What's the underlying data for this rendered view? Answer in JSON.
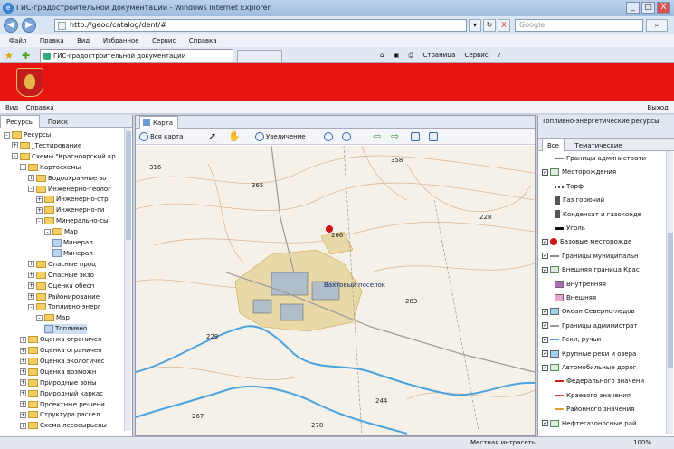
{
  "window": {
    "title": "ГИС-градостроительной документации - Windows Internet Explorer",
    "min": "_",
    "max": "□",
    "close": "X"
  },
  "address": {
    "url": "http://geod/catalog/dent/#",
    "go": "▾",
    "refresh": "↻",
    "stop": "X",
    "search_placeholder": "Google",
    "search_btn": "⌕"
  },
  "menu": [
    "Файл",
    "Правка",
    "Вид",
    "Избранное",
    "Сервис",
    "Справка"
  ],
  "browser_tab": {
    "title": "ГИС-градостроительной документации"
  },
  "commandbar": [
    "Страница",
    "Сервис"
  ],
  "appmenu": {
    "items": [
      "Вид",
      "Справка"
    ],
    "exit": "Выход"
  },
  "left_panel": {
    "tabs": [
      "Ресурсы",
      "Поиск"
    ],
    "tree": [
      {
        "label": "Ресурсы",
        "level": 0,
        "type": "folder",
        "toggle": "-"
      },
      {
        "label": "_Тестирование",
        "level": 1,
        "type": "folder",
        "toggle": "+"
      },
      {
        "label": "Схемы \"Красноярский кр",
        "level": 1,
        "type": "folder",
        "toggle": "-"
      },
      {
        "label": "Картосхемы",
        "level": 2,
        "type": "folder",
        "toggle": "-"
      },
      {
        "label": "Водоохранные зо",
        "level": 3,
        "type": "folder",
        "toggle": "+"
      },
      {
        "label": "Инженерно-геолог",
        "level": 3,
        "type": "folder",
        "toggle": "-"
      },
      {
        "label": "Инженерно-стр",
        "level": 4,
        "type": "folder",
        "toggle": "+"
      },
      {
        "label": "Инженерно-ги",
        "level": 4,
        "type": "folder",
        "toggle": "+"
      },
      {
        "label": "Минерально-сы",
        "level": 4,
        "type": "folder",
        "toggle": "-"
      },
      {
        "label": "Map",
        "level": 5,
        "type": "folder",
        "toggle": "-"
      },
      {
        "label": "Минерал",
        "level": 6,
        "type": "leaf",
        "toggle": ""
      },
      {
        "label": "Минерал",
        "level": 6,
        "type": "leaf",
        "toggle": ""
      },
      {
        "label": "Опасные проц",
        "level": 3,
        "type": "folder",
        "toggle": "+"
      },
      {
        "label": "Опасные экзо",
        "level": 3,
        "type": "folder",
        "toggle": "+"
      },
      {
        "label": "Оценка обесп",
        "level": 3,
        "type": "folder",
        "toggle": "+"
      },
      {
        "label": "Районирование",
        "level": 3,
        "type": "folder",
        "toggle": "+"
      },
      {
        "label": "Топливно-энерг",
        "level": 3,
        "type": "folder",
        "toggle": "-"
      },
      {
        "label": "Map",
        "level": 4,
        "type": "folder",
        "toggle": "-"
      },
      {
        "label": "Топливно",
        "level": 5,
        "type": "leaf",
        "toggle": "",
        "selected": true
      },
      {
        "label": "Оценка ограничен",
        "level": 2,
        "type": "folder",
        "toggle": "+"
      },
      {
        "label": "Оценка ограничен",
        "level": 2,
        "type": "folder",
        "toggle": "+"
      },
      {
        "label": "Оценка экологичес",
        "level": 2,
        "type": "folder",
        "toggle": "+"
      },
      {
        "label": "Оценка возможн",
        "level": 2,
        "type": "folder",
        "toggle": "+"
      },
      {
        "label": "Природные зоны",
        "level": 2,
        "type": "folder",
        "toggle": "+"
      },
      {
        "label": "Природный каркас",
        "level": 2,
        "type": "folder",
        "toggle": "+"
      },
      {
        "label": "Проектные решени",
        "level": 2,
        "type": "folder",
        "toggle": "+"
      },
      {
        "label": "Структура рассел",
        "level": 2,
        "type": "folder",
        "toggle": "+"
      },
      {
        "label": "Схема лесосырьевы",
        "level": 2,
        "type": "folder",
        "toggle": "+"
      }
    ]
  },
  "map": {
    "tab": "Карта",
    "toolbar": {
      "full_extent": "Вся карта",
      "zoom": "Увеличение"
    },
    "labels": [
      "Вахтовый поселок",
      "283",
      "358",
      "365",
      "228",
      "229",
      "267",
      "244",
      "278",
      "266",
      "316"
    ]
  },
  "right_panel": {
    "title": "Топливно-энергетические ресурсы",
    "tabs": [
      "Все",
      "Тематические"
    ],
    "items": [
      {
        "label": "Границы администрати",
        "checked": "",
        "swatch": "line",
        "color": "#7a7a7a"
      },
      {
        "label": "Месторождения",
        "checked": "✓",
        "swatch": "group",
        "color": "#5a8a5a"
      },
      {
        "label": "Торф",
        "checked": "",
        "swatch": "dots",
        "color": "#555555"
      },
      {
        "label": "Газ горючий",
        "checked": "",
        "swatch": "symbol",
        "color": "#555555"
      },
      {
        "label": "Конденсат и газоконде",
        "checked": "",
        "swatch": "symbol",
        "color": "#555555"
      },
      {
        "label": "Уголь",
        "checked": "",
        "swatch": "bar",
        "color": "#111111"
      },
      {
        "label": "Базовые месторожде",
        "checked": "✓",
        "swatch": "dot",
        "color": "#d11212"
      },
      {
        "label": "Границы муниципальн",
        "checked": "✓",
        "swatch": "dash",
        "color": "#8a8a8a"
      },
      {
        "label": "Внешняя граница Крас",
        "checked": "✓",
        "swatch": "group",
        "color": "#5a8a5a"
      },
      {
        "label": "Внутренняя",
        "checked": "",
        "swatch": "box",
        "color": "#b06ab0"
      },
      {
        "label": "Внешняя",
        "checked": "",
        "swatch": "box",
        "color": "#e7a8d3"
      },
      {
        "label": "Океан Северно-ледов",
        "checked": "✓",
        "swatch": "box",
        "color": "#9cd4f0"
      },
      {
        "label": "Границы администрат",
        "checked": "✓",
        "swatch": "line",
        "color": "#9a9a9a"
      },
      {
        "label": "Реки, ручьи",
        "checked": "✓",
        "swatch": "line",
        "color": "#4aa3df"
      },
      {
        "label": "Крупные реки и озера",
        "checked": "✓",
        "swatch": "box",
        "color": "#9cd4f0"
      },
      {
        "label": "Автомобильные дорог",
        "checked": "✓",
        "swatch": "group",
        "color": "#5a8a5a"
      },
      {
        "label": "Федерального значени",
        "checked": "",
        "swatch": "line",
        "color": "#d12020"
      },
      {
        "label": "Краевого значения",
        "checked": "",
        "swatch": "line",
        "color": "#e03a3a"
      },
      {
        "label": "Районного значения",
        "checked": "",
        "swatch": "line",
        "color": "#e0a030"
      },
      {
        "label": "Нефтегазоносные рай",
        "checked": "✓",
        "swatch": "group",
        "color": "#5a8a5a"
      }
    ]
  },
  "status": {
    "zone": "Местная интрасеть",
    "zoom": "100%"
  },
  "colors": {
    "banner": "#e8140f",
    "water": "#4aa3df",
    "road": "#9a9a9a"
  }
}
